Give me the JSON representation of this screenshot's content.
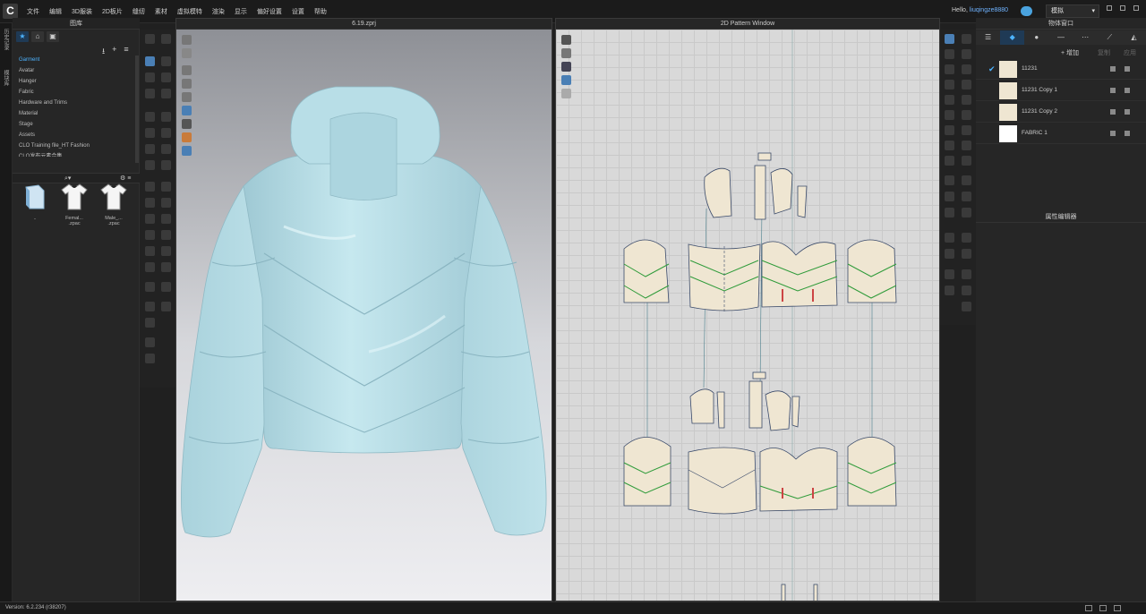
{
  "app": {
    "logo": "C"
  },
  "menu": [
    "文件",
    "编辑",
    "3D服装",
    "2D板片",
    "缝纫",
    "素材",
    "虚拟模特",
    "渲染",
    "显示",
    "偏好设置",
    "设置",
    "帮助"
  ],
  "user": {
    "greeting": "Hello,",
    "name": "liuqingze8880"
  },
  "mode": {
    "label": "模拟",
    "chevron": "▾"
  },
  "vertical_tabs": [
    "历史记录",
    "模块库"
  ],
  "library": {
    "title": "图库",
    "tab_icons": [
      "star-icon",
      "hanger-icon",
      "folder-icon"
    ],
    "actions": [
      "⭳",
      "+",
      "≡"
    ],
    "items": [
      "Garment",
      "Avatar",
      "Hanger",
      "Fabric",
      "Hardware and Trims",
      "Material",
      "Stage",
      "Assets",
      "CLO Training file_HT Fashion",
      "CLO发布元素合集"
    ],
    "selected_index": 0,
    "files": [
      {
        "name": "..",
        "icon": "folder-icon"
      },
      {
        "name": "Femal... .zpac",
        "icon": "tshirt-icon"
      },
      {
        "name": "Male_... .zpac",
        "icon": "tshirt-icon"
      }
    ]
  },
  "window3d": {
    "title": "6.19.zprj"
  },
  "window2d": {
    "title": "2D Pattern Window"
  },
  "object_browser": {
    "title": "物体窗口",
    "tab_icons": [
      "list-icon",
      "fabric-icon",
      "button-icon",
      "line-icon",
      "stitch-icon",
      "trim-icon",
      "hanger-icon"
    ],
    "add_label": "+ 增加",
    "copy_label": "复制",
    "apply_label": "应用",
    "fabrics": [
      {
        "name": "11231",
        "checked": true,
        "color": "#efe6d2"
      },
      {
        "name": "11231 Copy 1",
        "checked": false,
        "color": "#efe6d2"
      },
      {
        "name": "11231 Copy 2",
        "checked": false,
        "color": "#efe6d2"
      },
      {
        "name": "FABRIC 1",
        "checked": false,
        "color": "#ffffff"
      }
    ]
  },
  "property_editor": {
    "title": "属性编辑器"
  },
  "status": {
    "version": "Version: 6.2.234 (r38207)"
  },
  "colors": {
    "accent": "#4db3ff",
    "jacket": "#b4dbe4",
    "pattern_fill": "#efe6d2",
    "pattern_line": "#2f9b3a"
  }
}
